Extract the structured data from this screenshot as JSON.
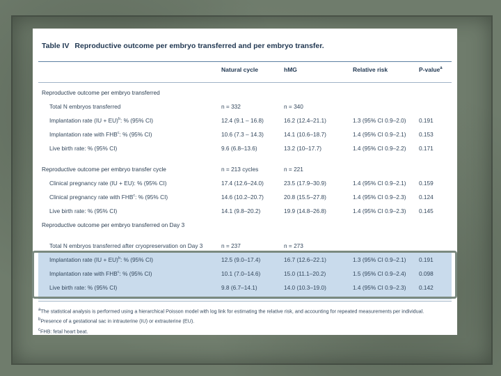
{
  "table": {
    "label": "Table IV",
    "title": "Reproductive outcome per embryo transferred and per embryo transfer.",
    "headers": [
      "Natural cycle",
      "hMG",
      "Relative risk",
      "P-value"
    ],
    "header_sup": "a",
    "rows": [
      {
        "label": "Reproductive outcome per embryo transferred",
        "sup": "",
        "section": true,
        "nc": "",
        "hmg": "",
        "rr": "",
        "p": ""
      },
      {
        "label": "Total N embryos transferred",
        "sup": "",
        "section": false,
        "nc": "n = 332",
        "hmg": "n = 340",
        "rr": "",
        "p": ""
      },
      {
        "label": "Implantation rate (IU + EU)",
        "sup": "b",
        "label_suffix": ": % (95% CI)",
        "section": false,
        "nc": "12.4 (9.1 – 16.8)",
        "hmg": "16.2 (12.4–21.1)",
        "rr": "1.3 (95% CI 0.9–2.0)",
        "p": "0.191"
      },
      {
        "label": "Implantation rate with FHB",
        "sup": "c",
        "label_suffix": ": % (95% CI)",
        "section": false,
        "nc": "10.6 (7.3 – 14.3)",
        "hmg": "14.1 (10.6–18.7)",
        "rr": "1.4 (95% CI 0.9–2.1)",
        "p": "0.153"
      },
      {
        "label": "Live birth rate: % (95% CI)",
        "sup": "",
        "section": false,
        "nc": "9.6 (6.8–13.6)",
        "hmg": "13.2 (10–17.7)",
        "rr": "1.4 (95% CI 0.9–2.2)",
        "p": "0.171"
      },
      {
        "label": "Reproductive outcome per embryo transfer cycle",
        "sup": "",
        "section": true,
        "nc": "n = 213 cycles",
        "hmg": "n = 221",
        "rr": "",
        "p": ""
      },
      {
        "label": "Clinical pregnancy rate (IU + EU): % (95% CI)",
        "sup": "",
        "section": false,
        "nc": "17.4 (12.6–24.0)",
        "hmg": "23.5 (17.9–30.9)",
        "rr": "1.4 (95% CI 0.9–2.1)",
        "p": "0.159"
      },
      {
        "label": "Clinical pregnancy rate with FHB",
        "sup": "c",
        "label_suffix": ": % (95% CI)",
        "section": false,
        "nc": "14.6 (10.2–20.7)",
        "hmg": "20.8 (15.5–27.8)",
        "rr": "1.4 (95% CI 0.9–2.3)",
        "p": "0.124"
      },
      {
        "label": "Live birth rate: % (95% CI)",
        "sup": "",
        "section": false,
        "nc": "14.1 (9.8–20.2)",
        "hmg": "19.9 (14.8–26.8)",
        "rr": "1.4 (95% CI 0.9–2.3)",
        "p": "0.145"
      },
      {
        "label": "Reproductive outcome per embryo transferred on Day 3",
        "sup": "",
        "section": true,
        "nc": "",
        "hmg": "",
        "rr": "",
        "p": ""
      },
      {
        "label": "Total N embryos transferred after cryopreservation on Day 3",
        "sup": "",
        "section": false,
        "nc": "n = 237",
        "hmg": "n = 273",
        "rr": "",
        "p": ""
      },
      {
        "label": "Implantation rate (IU + EU)",
        "sup": "b",
        "label_suffix": ": % (95% CI)",
        "section": false,
        "nc": "12.5 (9.0–17.4)",
        "hmg": "16.7 (12.6–22.1)",
        "rr": "1.3 (95% CI 0.9–2.1)",
        "p": "0.191"
      },
      {
        "label": "Implantation rate with FHB",
        "sup": "c",
        "label_suffix": ": % (95% CI)",
        "section": false,
        "nc": "10.1 (7.0–14.6)",
        "hmg": "15.0 (11.1–20.2)",
        "rr": "1.5 (95% CI 0.9–2.4)",
        "p": "0.098"
      },
      {
        "label": "Live birth rate: % (95% CI)",
        "sup": "",
        "section": false,
        "nc": "9.8 (6.7–14.1)",
        "hmg": "14.0 (10.3–19.0)",
        "rr": "1.4 (95% CI 0.9–2.3)",
        "p": "0.142"
      }
    ],
    "footnotes": [
      {
        "sup": "a",
        "text": "The statistical analysis is performed using a hierarchical Poisson model with log link for estimating the relative risk, and accounting for repeated measurements per individual."
      },
      {
        "sup": "b",
        "text": "Presence of a gestational sac in intrauterine (IU) or extrauterine (EU)."
      },
      {
        "sup": "c",
        "text": "FHB: fetal heart beat."
      }
    ]
  },
  "colors": {
    "background": "#6f7c6c",
    "paper": "#ffffff",
    "title_blue": "#1f3650",
    "section_shade": "#c9dbec",
    "highlight_border": "#7b8a80"
  }
}
